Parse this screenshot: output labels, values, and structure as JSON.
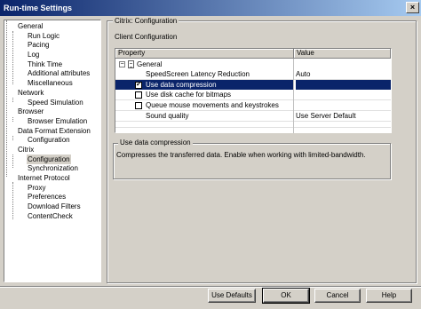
{
  "window": {
    "title": "Run-time Settings",
    "close_glyph": "×"
  },
  "tree": [
    {
      "label": "General"
    },
    {
      "label": "Run Logic"
    },
    {
      "label": "Pacing"
    },
    {
      "label": "Log"
    },
    {
      "label": "Think Time"
    },
    {
      "label": "Additional attributes"
    },
    {
      "label": "Miscellaneous"
    },
    {
      "label": "Network"
    },
    {
      "label": "Speed Simulation"
    },
    {
      "label": "Browser"
    },
    {
      "label": "Browser Emulation"
    },
    {
      "label": "Data Format Extension"
    },
    {
      "label": "Configuration"
    },
    {
      "label": "Citrix"
    },
    {
      "label": "Configuration"
    },
    {
      "label": "Synchronization"
    },
    {
      "label": "Internet Protocol"
    },
    {
      "label": "Proxy"
    },
    {
      "label": "Preferences"
    },
    {
      "label": "Download Filters"
    },
    {
      "label": "ContentCheck"
    }
  ],
  "panel": {
    "group_title": "Citrix: Configuration",
    "subtitle": "Client Configuration",
    "columns": {
      "property": "Property",
      "value": "Value"
    },
    "group_row": {
      "expander": "−",
      "label": "General"
    },
    "rows": [
      {
        "property": "SpeedScreen Latency Reduction",
        "value": "Auto",
        "checkbox": null
      },
      {
        "property": "Use data compression",
        "value": "",
        "checkbox": true
      },
      {
        "property": "Use disk cache for bitmaps",
        "value": "",
        "checkbox": false
      },
      {
        "property": "Queue mouse movements and keystrokes",
        "value": "",
        "checkbox": false
      },
      {
        "property": "Sound quality",
        "value": "Use Server Default",
        "checkbox": null
      }
    ],
    "checkmark_glyph": "✔"
  },
  "description": {
    "title": "Use data compression",
    "text": "Compresses the transferred data. Enable when working with limited-bandwidth."
  },
  "buttons": {
    "use_defaults": "Use Defaults",
    "ok": "OK",
    "cancel": "Cancel",
    "help": "Help"
  },
  "colors": {
    "title_start": "#0a246a",
    "title_end": "#a6caf0",
    "selection": "#0a246a",
    "face": "#d4d0c8"
  }
}
